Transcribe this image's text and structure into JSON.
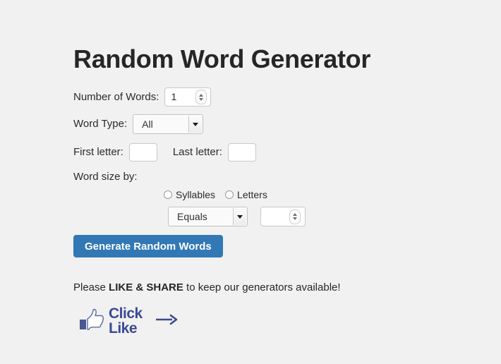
{
  "page": {
    "background_color": "#f1f1f1",
    "title": "Random Word Generator"
  },
  "form": {
    "number_of_words": {
      "label": "Number of Words:",
      "value": "1",
      "spinner_up_icon": "chevron-up-icon",
      "spinner_down_icon": "chevron-down-icon"
    },
    "word_type": {
      "label": "Word Type:",
      "selected": "All",
      "caret_icon": "caret-down-icon"
    },
    "first_letter": {
      "label": "First letter:",
      "value": "",
      "placeholder": ""
    },
    "last_letter": {
      "label": "Last letter:",
      "value": "",
      "placeholder": ""
    },
    "word_size": {
      "label": "Word size by:",
      "radios": [
        {
          "label": "Syllables",
          "checked": false
        },
        {
          "label": "Letters",
          "checked": false
        }
      ],
      "comparison": {
        "selected": "Equals",
        "caret_icon": "caret-down-icon"
      },
      "amount": {
        "value": "",
        "spinner_up_icon": "chevron-up-icon",
        "spinner_down_icon": "chevron-down-icon"
      }
    },
    "generate_button": {
      "label": "Generate Random Words",
      "color": "#3178b5",
      "text_color": "#ffffff"
    }
  },
  "share": {
    "prefix": "Please ",
    "emphasis": "LIKE & SHARE",
    "suffix": " to keep our generators available!",
    "badge": {
      "thumb_icon": "thumbs-up-icon",
      "line1": "Click",
      "line2": "Like",
      "arrow_icon": "arrow-right-icon",
      "color": "#3b4a94"
    }
  }
}
